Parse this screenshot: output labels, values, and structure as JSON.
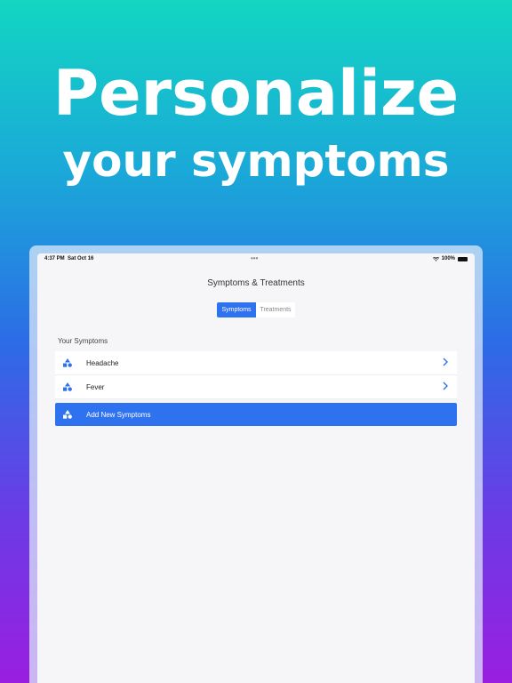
{
  "headline": {
    "line1": "Personalize",
    "line2": "your symptoms"
  },
  "status_bar": {
    "time": "4:37 PM",
    "date": "Sat Oct 16",
    "battery": "100%"
  },
  "nav": {
    "title": "Symptoms & Treatments"
  },
  "tabs": [
    {
      "label": "Symptoms",
      "selected": true
    },
    {
      "label": "Treatments",
      "selected": false
    }
  ],
  "section": {
    "label": "Your Symptoms"
  },
  "symptoms": [
    {
      "label": "Headache",
      "icon": "shapes-icon"
    },
    {
      "label": "Fever",
      "icon": "shapes-icon"
    }
  ],
  "add_button": {
    "label": "Add New Symptoms",
    "icon": "shapes-icon"
  },
  "colors": {
    "accent": "#2f72f0"
  }
}
